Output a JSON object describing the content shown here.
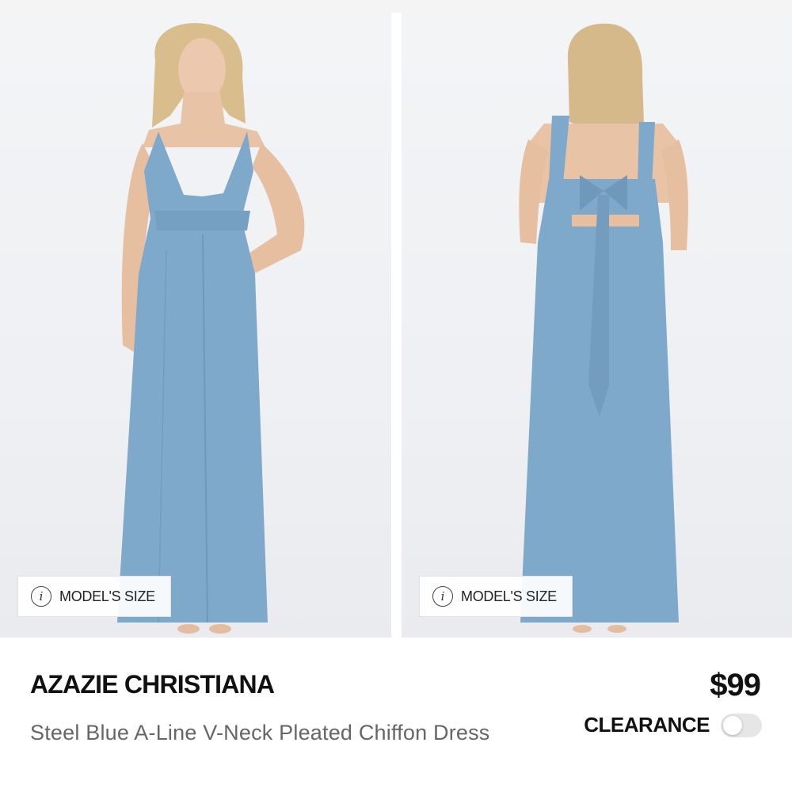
{
  "gallery": {
    "images": [
      {
        "view": "front",
        "model_size_label": "MODEL'S SIZE"
      },
      {
        "view": "back",
        "model_size_label": "MODEL'S SIZE"
      }
    ],
    "dress_color": "#7fa9cb",
    "skin_color": "#e8c3a6",
    "hair_color": "#d9bd8c"
  },
  "product": {
    "brand": "AZAZIE CHRISTIANA",
    "title": "Steel Blue A-Line V-Neck Pleated Chiffon Dress",
    "price": "$99",
    "clearance_label": "CLEARANCE",
    "clearance_toggle_on": false
  }
}
